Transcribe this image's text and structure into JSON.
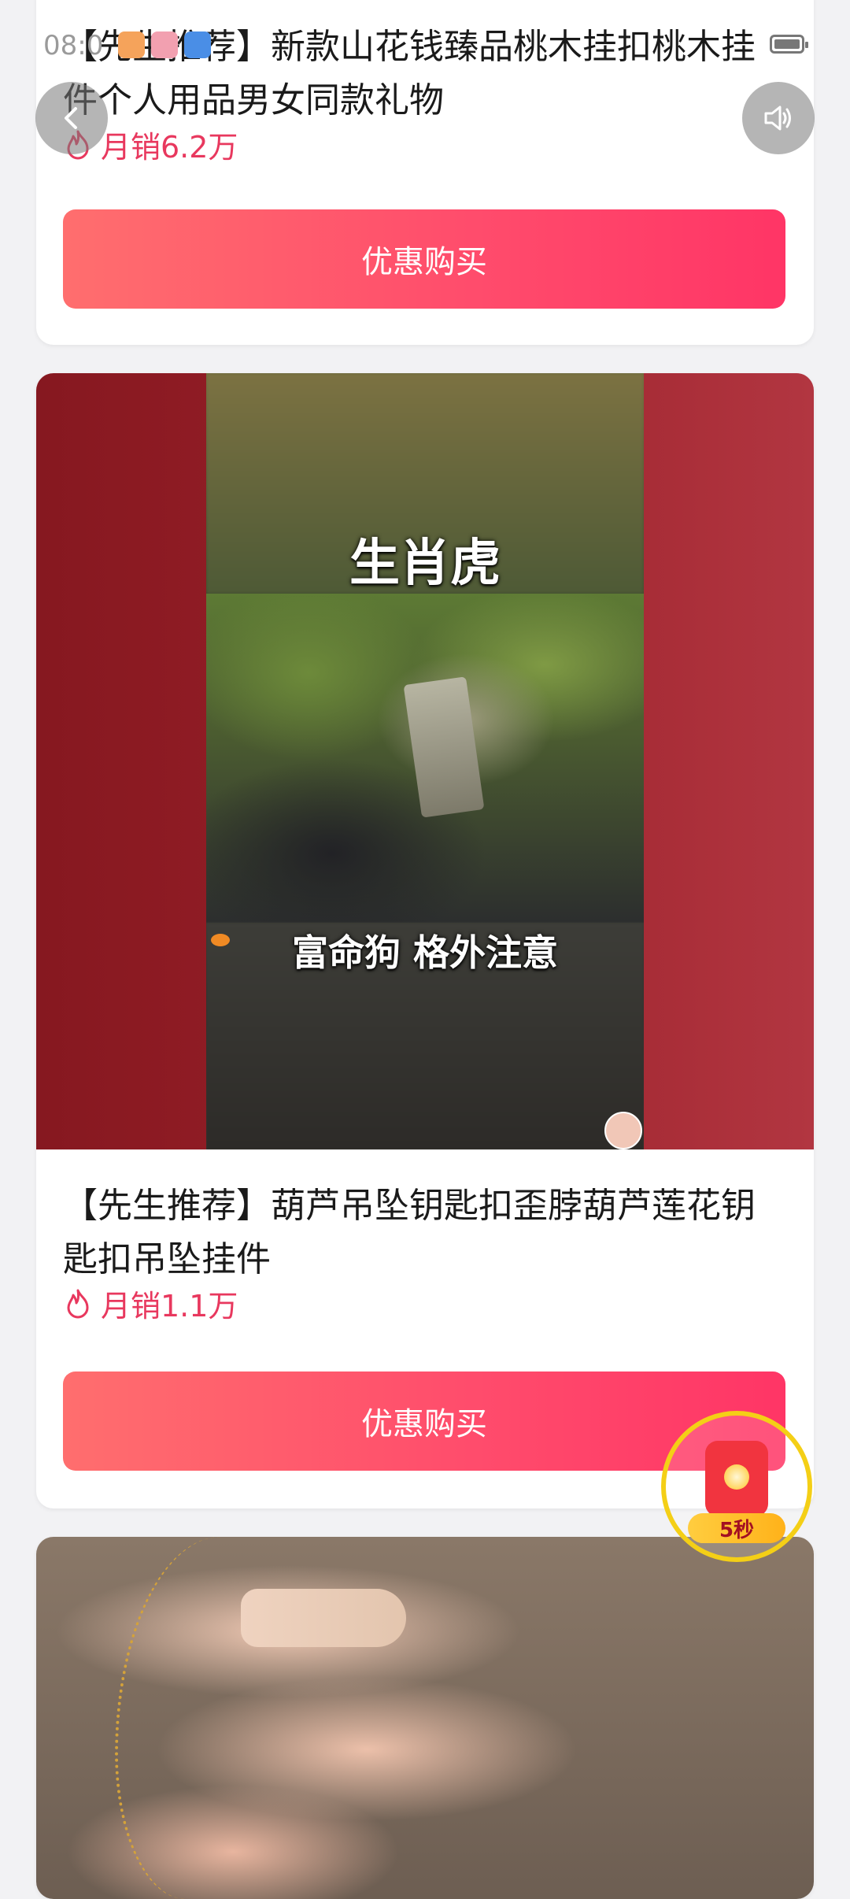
{
  "status_bar": {
    "time": "08:0",
    "battery_icon": "battery-icon"
  },
  "nav": {
    "back_icon": "chevron-left-icon",
    "sound_icon": "speaker-icon"
  },
  "products": [
    {
      "title": "【先生推荐】新款山花钱臻品桃木挂扣桃木挂件个人用品男女同款礼物",
      "sales": "月销6.2万",
      "buy_label": "优惠购买"
    },
    {
      "title": "【先生推荐】葫芦吊坠钥匙扣歪脖葫芦莲花钥匙扣吊坠挂件",
      "sales": "月销1.1万",
      "buy_label": "优惠购买",
      "video": {
        "caption_top": "生肖虎",
        "caption_bottom": "富命狗 格外注意"
      }
    }
  ],
  "floating_redpacket": {
    "timer": "5秒"
  },
  "colors": {
    "accent": "#ff3d66",
    "sales_text": "#e8385e",
    "video_bg": "#9a2029",
    "ring": "#f4cf16"
  }
}
